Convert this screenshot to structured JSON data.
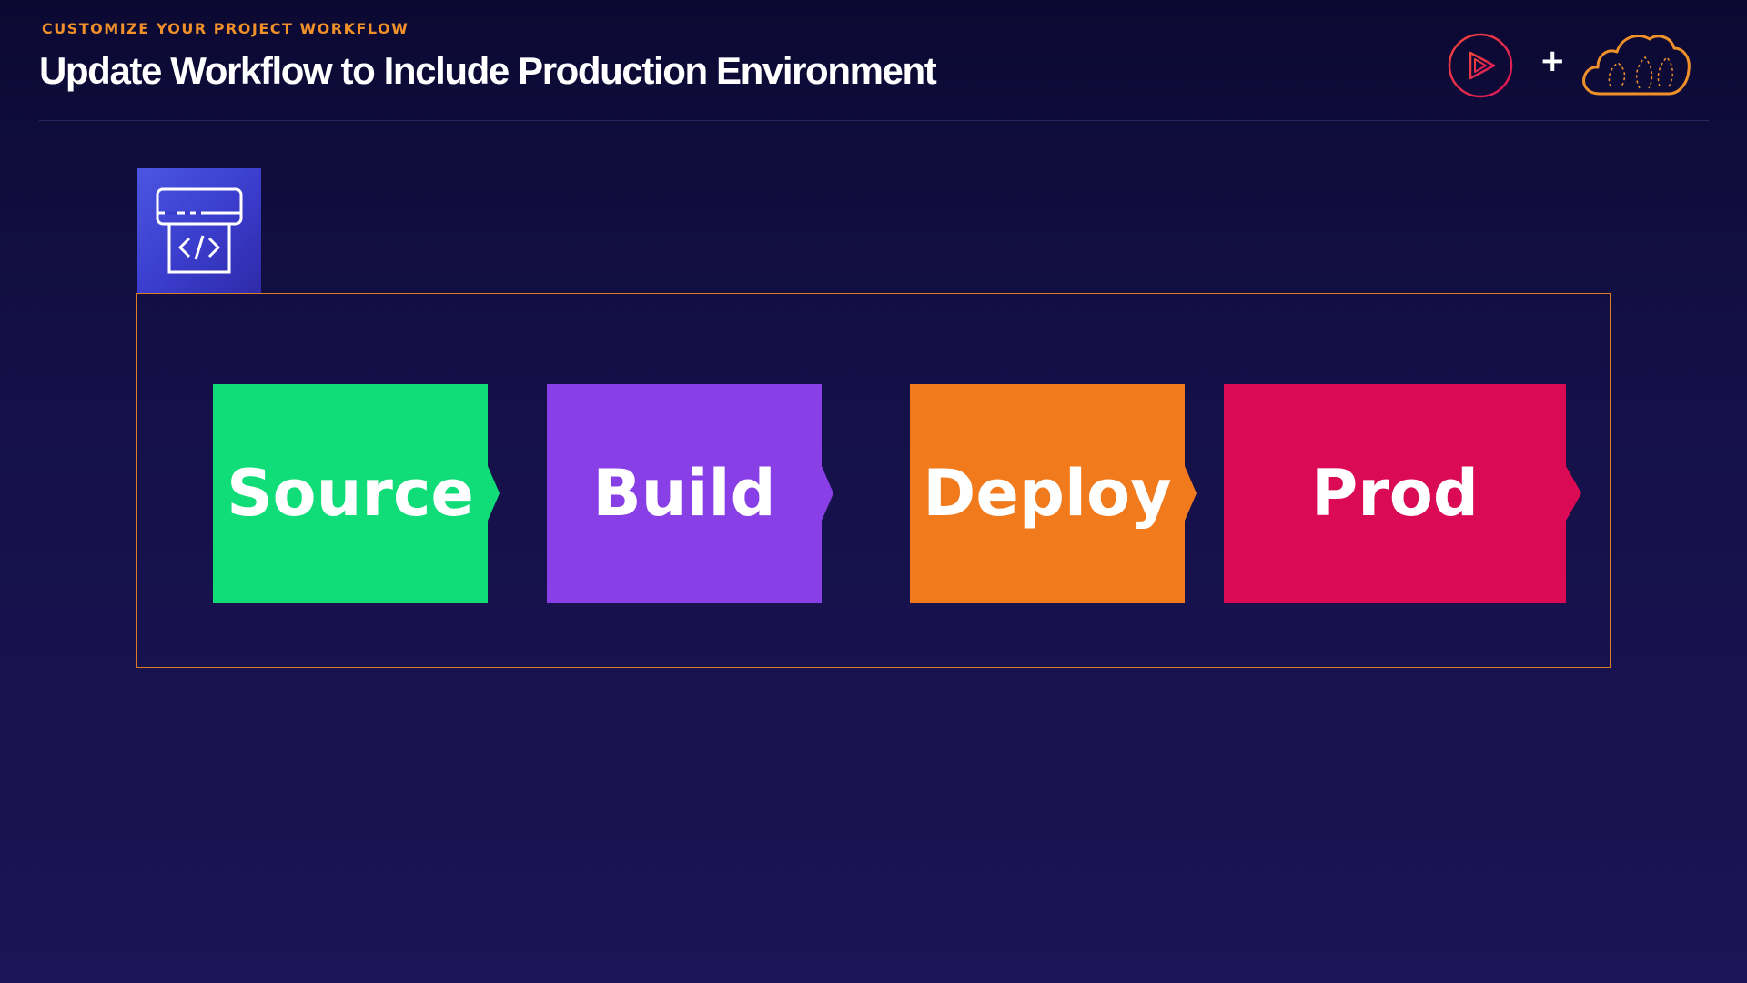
{
  "header": {
    "kicker": "CUSTOMIZE YOUR PROJECT WORKFLOW",
    "title": "Update Workflow to Include Production Environment"
  },
  "logos": {
    "left_icon": "pluralsight-play-icon",
    "plus": "+",
    "right_icon": "cloud-logo-icon"
  },
  "service_icon": "code-pipeline-icon",
  "pipeline": {
    "stages": [
      {
        "label": "Source",
        "color": "#10dc78"
      },
      {
        "label": "Build",
        "color": "#8840e6"
      },
      {
        "label": "Deploy",
        "color": "#f07a1c"
      },
      {
        "label": "Prod",
        "color": "#da0b54"
      }
    ]
  },
  "colors": {
    "accent": "#f0902a",
    "frame": "#e07a24",
    "icon_bg": "#3a3ccb"
  }
}
